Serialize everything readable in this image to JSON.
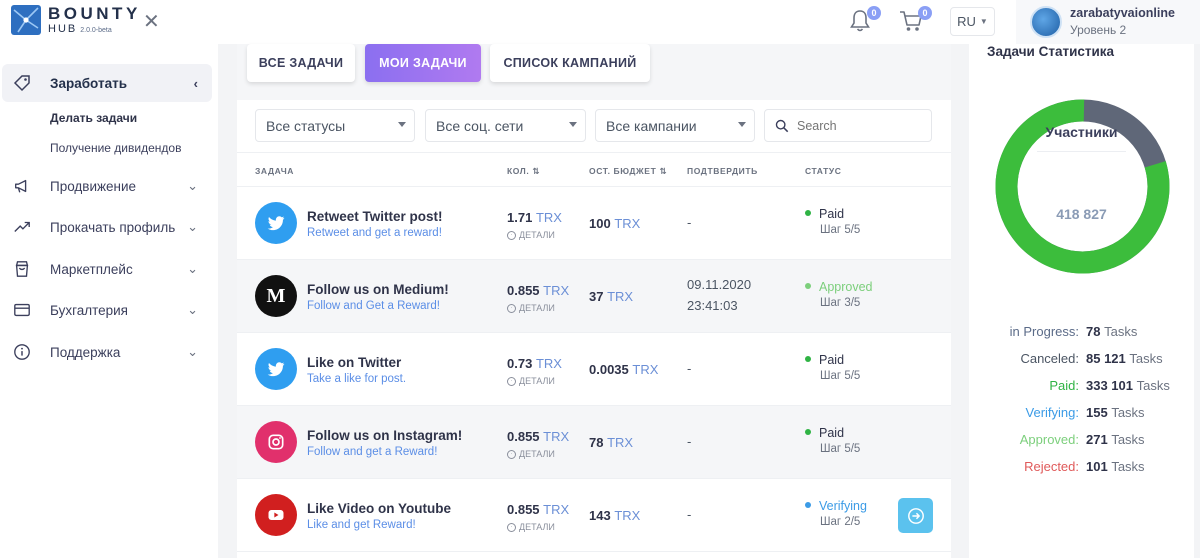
{
  "brand": {
    "title": "BOUNTY",
    "sub": "HUB",
    "version": "2.0.0-beta"
  },
  "header": {
    "notifications_badge": "0",
    "cart_badge": "0",
    "lang": "RU",
    "user_name": "zarabatyvaionline",
    "user_level": "Уровень 2"
  },
  "sidebar": {
    "active": {
      "label": "Заработать"
    },
    "submenu": [
      "Делать задачи",
      "Получение дивидендов"
    ],
    "items": [
      {
        "label": "Продвижение",
        "icon": "megaphone-icon"
      },
      {
        "label": "Прокачать профиль",
        "icon": "trending-up-icon"
      },
      {
        "label": "Маркетплейс",
        "icon": "bag-icon"
      },
      {
        "label": "Бухгалтерия",
        "icon": "credit-card-icon"
      },
      {
        "label": "Поддержка",
        "icon": "info-icon"
      }
    ]
  },
  "tabs": [
    "ВСЕ ЗАДАЧИ",
    "МОИ ЗАДАЧИ",
    "СПИСОК КАМПАНИЙ"
  ],
  "active_tab": 1,
  "filters": {
    "status": "Все статусы",
    "social": "Все соц. сети",
    "campaign": "Все кампании",
    "search_placeholder": "Search"
  },
  "table": {
    "headers": [
      "ЗАДАЧА",
      "КОЛ.",
      "ОСТ. БЮДЖЕТ",
      "ПОДТВЕРДИТЬ",
      "СТАТУС"
    ],
    "rows": [
      {
        "title": "Retweet Twitter post!",
        "sub": "Retweet and get a reward!",
        "icon": "twitter-icon",
        "qty": "1.71",
        "qty_cur": "TRX",
        "details": "ДЕТАЛИ",
        "budget": "100",
        "budget_cur": "TRX",
        "confirm": "-",
        "confirm2": "",
        "status": "Paid",
        "step": "Шаг 5/5",
        "status_color": "#2fb344"
      },
      {
        "title": "Follow us on Medium!",
        "sub": "Follow and Get a Reward!",
        "icon": "medium-icon",
        "qty": "0.855",
        "qty_cur": "TRX",
        "details": "ДЕТАЛИ",
        "budget": "37",
        "budget_cur": "TRX",
        "confirm": "09.11.2020",
        "confirm2": "23:41:03",
        "status": "Approved",
        "step": "Шаг 3/5",
        "status_color": "#7ccf7c"
      },
      {
        "title": "Like on Twitter",
        "sub": "Take a like for post.",
        "icon": "twitter-icon",
        "qty": "0.73",
        "qty_cur": "TRX",
        "details": "ДЕТАЛИ",
        "budget": "0.0035",
        "budget_cur": "TRX",
        "confirm": "-",
        "confirm2": "",
        "status": "Paid",
        "step": "Шаг 5/5",
        "status_color": "#2fb344"
      },
      {
        "title": "Follow us on Instagram!",
        "sub": "Follow and get a Reward!",
        "icon": "instagram-icon",
        "qty": "0.855",
        "qty_cur": "TRX",
        "details": "ДЕТАЛИ",
        "budget": "78",
        "budget_cur": "TRX",
        "confirm": "-",
        "confirm2": "",
        "status": "Paid",
        "step": "Шаг 5/5",
        "status_color": "#2fb344"
      },
      {
        "title": "Like Video on Youtube",
        "sub": "Like and get Reward!",
        "icon": "youtube-icon",
        "qty": "0.855",
        "qty_cur": "TRX",
        "details": "ДЕТАЛИ",
        "budget": "143",
        "budget_cur": "TRX",
        "confirm": "-",
        "confirm2": "",
        "status": "Verifying",
        "step": "Шаг 2/5",
        "status_color": "#3b9be6"
      }
    ]
  },
  "stats": {
    "title": "Задачи Статистика",
    "donut_label": "Участники",
    "donut_value": "418 827",
    "donut_colors": {
      "paid": "#3cbd3c",
      "other": "#5f6778"
    },
    "paid_fraction": 0.8,
    "unit": "Tasks",
    "rows": [
      {
        "label": "in Progress:",
        "value": "78",
        "color": "#5b6b88"
      },
      {
        "label": "Canceled:",
        "value": "85 121",
        "color": "#4b5563"
      },
      {
        "label": "Paid:",
        "value": "333 101",
        "color": "#2fb344"
      },
      {
        "label": "Verifying:",
        "value": "155",
        "color": "#3b9be6"
      },
      {
        "label": "Approved:",
        "value": "271",
        "color": "#7ccf7c"
      },
      {
        "label": "Rejected:",
        "value": "101",
        "color": "#e05a5a"
      }
    ]
  }
}
